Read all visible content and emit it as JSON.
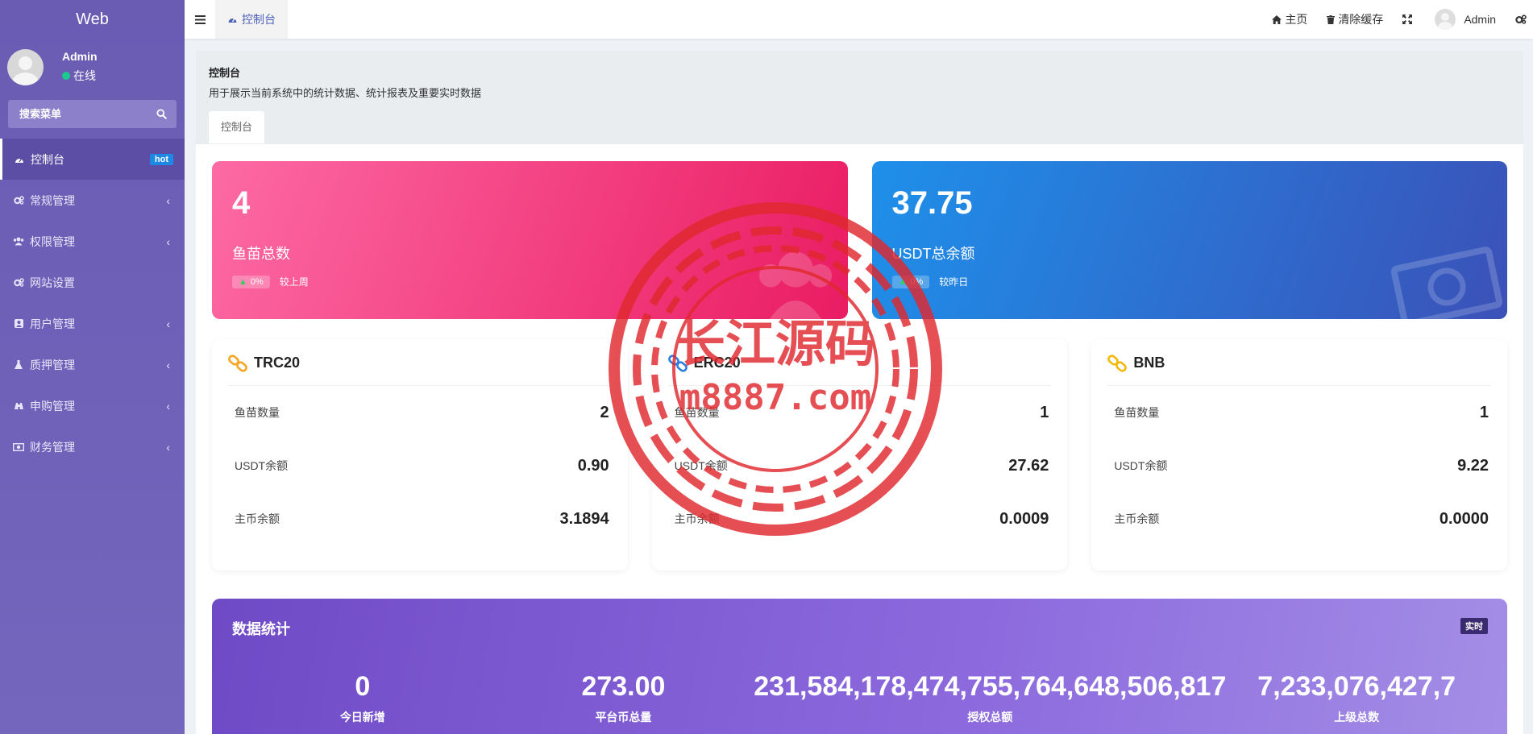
{
  "brand": "Web",
  "user": {
    "name": "Admin",
    "status": "在线"
  },
  "search": {
    "placeholder": "搜索菜单"
  },
  "menu": [
    {
      "label": "控制台",
      "icon": "dashboard-icon",
      "badge": "hot",
      "active": true
    },
    {
      "label": "常规管理",
      "icon": "cogs-icon"
    },
    {
      "label": "权限管理",
      "icon": "group-icon"
    },
    {
      "label": "网站设置",
      "icon": "cogs-icon"
    },
    {
      "label": "用户管理",
      "icon": "user-square-icon"
    },
    {
      "label": "质押管理",
      "icon": "flask-icon"
    },
    {
      "label": "申购管理",
      "icon": "binoculars-icon"
    },
    {
      "label": "财务管理",
      "icon": "money-icon"
    }
  ],
  "header": {
    "tab_label": "控制台",
    "home": "主页",
    "clear_cache": "清除缓存",
    "admin": "Admin"
  },
  "page": {
    "title": "控制台",
    "description": "用于展示当前系统中的统计数据、统计报表及重要实时数据",
    "tab": "控制台"
  },
  "stats": [
    {
      "value": "4",
      "label": "鱼苗总数",
      "pct": "0%",
      "compare": "较上周",
      "color": "#ea1c62"
    },
    {
      "value": "37.75",
      "label": "USDT总余额",
      "pct": "0%",
      "compare": "较昨日",
      "color": "#1e90ea"
    }
  ],
  "chains": [
    {
      "name": "TRC20",
      "icon": "link-icon",
      "icon_color": "#f5a623",
      "rows": [
        {
          "label": "鱼苗数量",
          "value": "2"
        },
        {
          "label": "USDT余额",
          "value": "0.90"
        },
        {
          "label": "主币余额",
          "value": "3.1894"
        }
      ]
    },
    {
      "name": "ERC20",
      "icon": "link-icon",
      "icon_color": "#2a7de1",
      "rows": [
        {
          "label": "鱼苗数量",
          "value": "1"
        },
        {
          "label": "USDT余额",
          "value": "27.62"
        },
        {
          "label": "主币余额",
          "value": "0.0009"
        }
      ]
    },
    {
      "name": "BNB",
      "icon": "link-icon",
      "icon_color": "#f0b90b",
      "rows": [
        {
          "label": "鱼苗数量",
          "value": "1"
        },
        {
          "label": "USDT余额",
          "value": "9.22"
        },
        {
          "label": "主币余额",
          "value": "0.0000"
        }
      ]
    }
  ],
  "data_stats": {
    "title": "数据统计",
    "badge": "实时",
    "items": [
      {
        "value": "0",
        "label": "今日新增"
      },
      {
        "value": "273.00",
        "label": "平台币总量"
      },
      {
        "value": "231,584,178,474,755,764,648,506,817",
        "label": "授权总额"
      },
      {
        "value": "7,233,076,427,7",
        "label": "上级总数"
      }
    ]
  },
  "watermark": {
    "line1": "长江源码",
    "line2": "m8887.com",
    "color": "#e0282e"
  }
}
